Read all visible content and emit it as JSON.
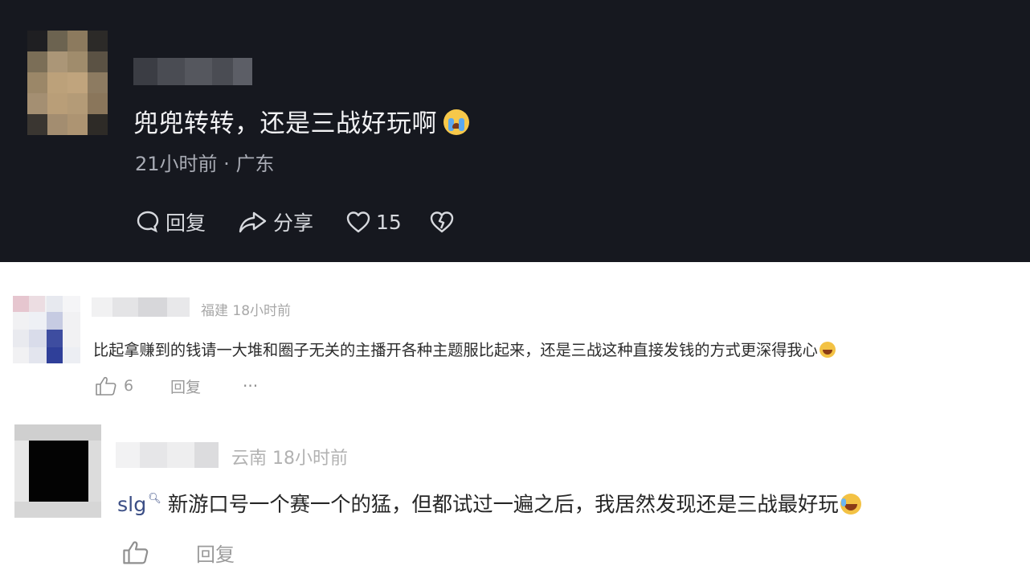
{
  "comments": [
    {
      "text": "兜兜转转，还是三战好玩啊",
      "time": "21小时前",
      "separator": " · ",
      "location": "广东",
      "reply_label": "回复",
      "share_label": "分享",
      "like_count": "15",
      "emoji": "crying-face"
    },
    {
      "location": "福建",
      "time": "18小时前",
      "text": "比起拿赚到的钱请一大堆和圈子无关的主播开各种主题服比起来，还是三战这种直接发钱的方式更深得我心",
      "like_count": "6",
      "reply_label": "回复",
      "more_label": "···",
      "emoji": "laughing-face"
    },
    {
      "location": "云南",
      "time": "18小时前",
      "tag": "slg",
      "text": "新游口号一个赛一个的猛，但都试过一遍之后，我居然发现还是三战最好玩",
      "reply_label": "回复",
      "emoji": "laughing-tears-face"
    }
  ],
  "colors": {
    "dark_background": "#16181f",
    "dark_text": "#f2f2f4",
    "dark_meta": "#a8abb4",
    "light_text": "#2c2c2c",
    "light_meta": "#a7a7a7",
    "tag_link": "#3c4f86"
  }
}
